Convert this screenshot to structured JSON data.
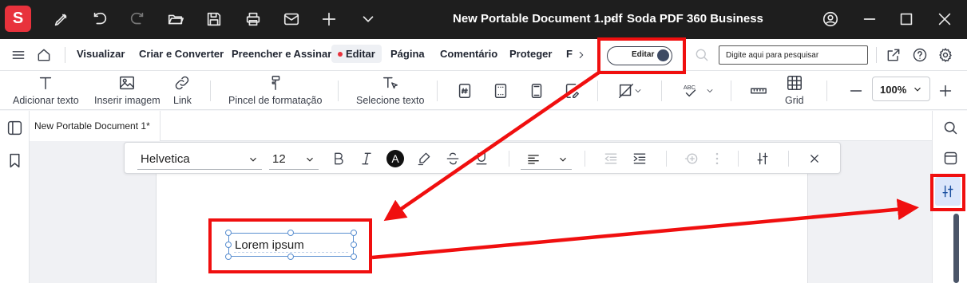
{
  "titlebar": {
    "logo_letter": "S",
    "document_title": "New Portable Document 1.pdf",
    "separator": "-",
    "app_name": "Soda PDF 360 Business"
  },
  "menu": {
    "items": [
      "Visualizar",
      "Criar e Converter",
      "Preencher e Assinar",
      "Editar",
      "Página",
      "Comentário",
      "Proteger",
      "F"
    ],
    "active": "Editar",
    "toggle_label": "Editar",
    "search_placeholder": "Digite aqui para pesquisar"
  },
  "ribbon": {
    "add_text": "Adicionar texto",
    "insert_image": "Inserir imagem",
    "link": "Link",
    "format_brush": "Pincel de formatação",
    "select_text": "Selecione texto",
    "grid": "Grid",
    "zoom": "100%"
  },
  "tabs": {
    "doc_tab": "New Portable Document 1*"
  },
  "format_toolbar": {
    "font": "Helvetica",
    "size": "12",
    "color_letter": "A"
  },
  "document": {
    "textbox_text": "Lorem ipsum"
  },
  "colors": {
    "brand": "#e8323c",
    "annotation": "#f00f0f",
    "active_panel": "#dbe6fb"
  }
}
